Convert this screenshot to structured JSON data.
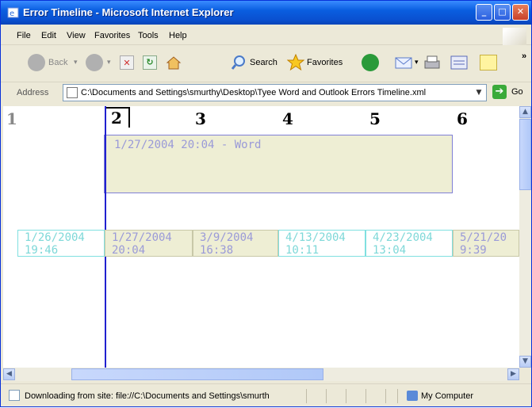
{
  "window": {
    "title": "Error Timeline - Microsoft Internet Explorer"
  },
  "menu": [
    "File",
    "Edit",
    "View",
    "Favorites",
    "Tools",
    "Help"
  ],
  "toolbar": {
    "back_label": "Back",
    "search_label": "Search",
    "favorites_label": "Favorites"
  },
  "address": {
    "label": "Address",
    "url": "C:\\Documents and Settings\\smurthy\\Desktop\\Tyee Word and Outlook Errors Timeline.xml",
    "go_label": "Go"
  },
  "timeline": {
    "columns": [
      "1",
      "2",
      "3",
      "4",
      "5",
      "6"
    ],
    "selected_event": "1/27/2004 20:04 - Word",
    "events": [
      {
        "date": "1/26/2004",
        "time": "19:46"
      },
      {
        "date": "1/27/2004",
        "time": "20:04"
      },
      {
        "date": "3/9/2004",
        "time": "16:38"
      },
      {
        "date": "4/13/2004",
        "time": "10:11"
      },
      {
        "date": "4/23/2004",
        "time": "13:04"
      },
      {
        "date": "5/21/20",
        "time": "9:39"
      }
    ]
  },
  "status": {
    "text": "Downloading from site: file://C:\\Documents and Settings\\smurth",
    "zone": "My Computer"
  },
  "colors": {
    "title_bar": "#0a5ee0",
    "timeline_line": "#2020d0",
    "event_box": "#eeeed4",
    "cyan_text": "#7ed8d8",
    "purple_text": "#9a9ad8"
  }
}
